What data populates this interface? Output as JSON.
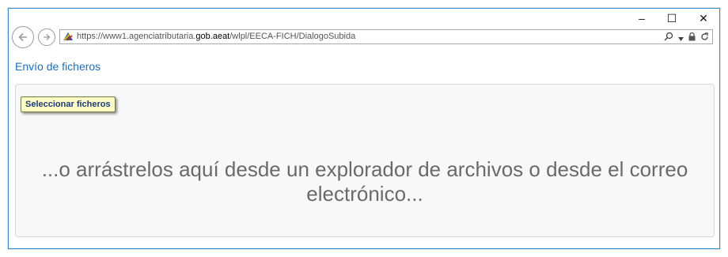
{
  "window": {
    "controls": {
      "minimize": "–",
      "maximize": "☐",
      "close": "✕"
    }
  },
  "browser": {
    "url_prefix": "https://www1.agenciatributaria.",
    "url_domain": "gob.aeat",
    "url_path": "/wlpl/EECA-FICH/DialogoSubida",
    "icons": [
      "back-arrow-icon",
      "forward-arrow-icon",
      "site-favicon",
      "search-icon",
      "dropdown-arrow-icon",
      "lock-icon",
      "refresh-icon"
    ]
  },
  "page": {
    "title": "Envío de ficheros",
    "select_button": "Seleccionar ficheros",
    "drop_hint": "...o arrástrelos aquí desde un explorador de archivos o desde el correo electrónico..."
  }
}
